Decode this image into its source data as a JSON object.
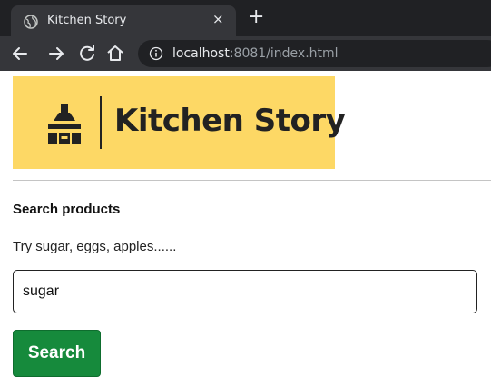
{
  "browser": {
    "tab_title": "Kitchen Story",
    "tab_close": "×",
    "new_tab": "+",
    "url_host": "localhost",
    "url_rest": ":8081/index.html",
    "icons": [
      "globe-icon",
      "back-arrow-icon",
      "forward-arrow-icon",
      "reload-icon",
      "home-icon",
      "info-icon"
    ]
  },
  "banner": {
    "brand_name": "Kitchen Story",
    "background_color": "#fdd865",
    "icon": "kitchen-hood-icon"
  },
  "search": {
    "heading": "Search products",
    "hint": "Try sugar, eggs, apples......",
    "input_value": "sugar",
    "button_label": "Search",
    "button_color": "#168a3c"
  }
}
